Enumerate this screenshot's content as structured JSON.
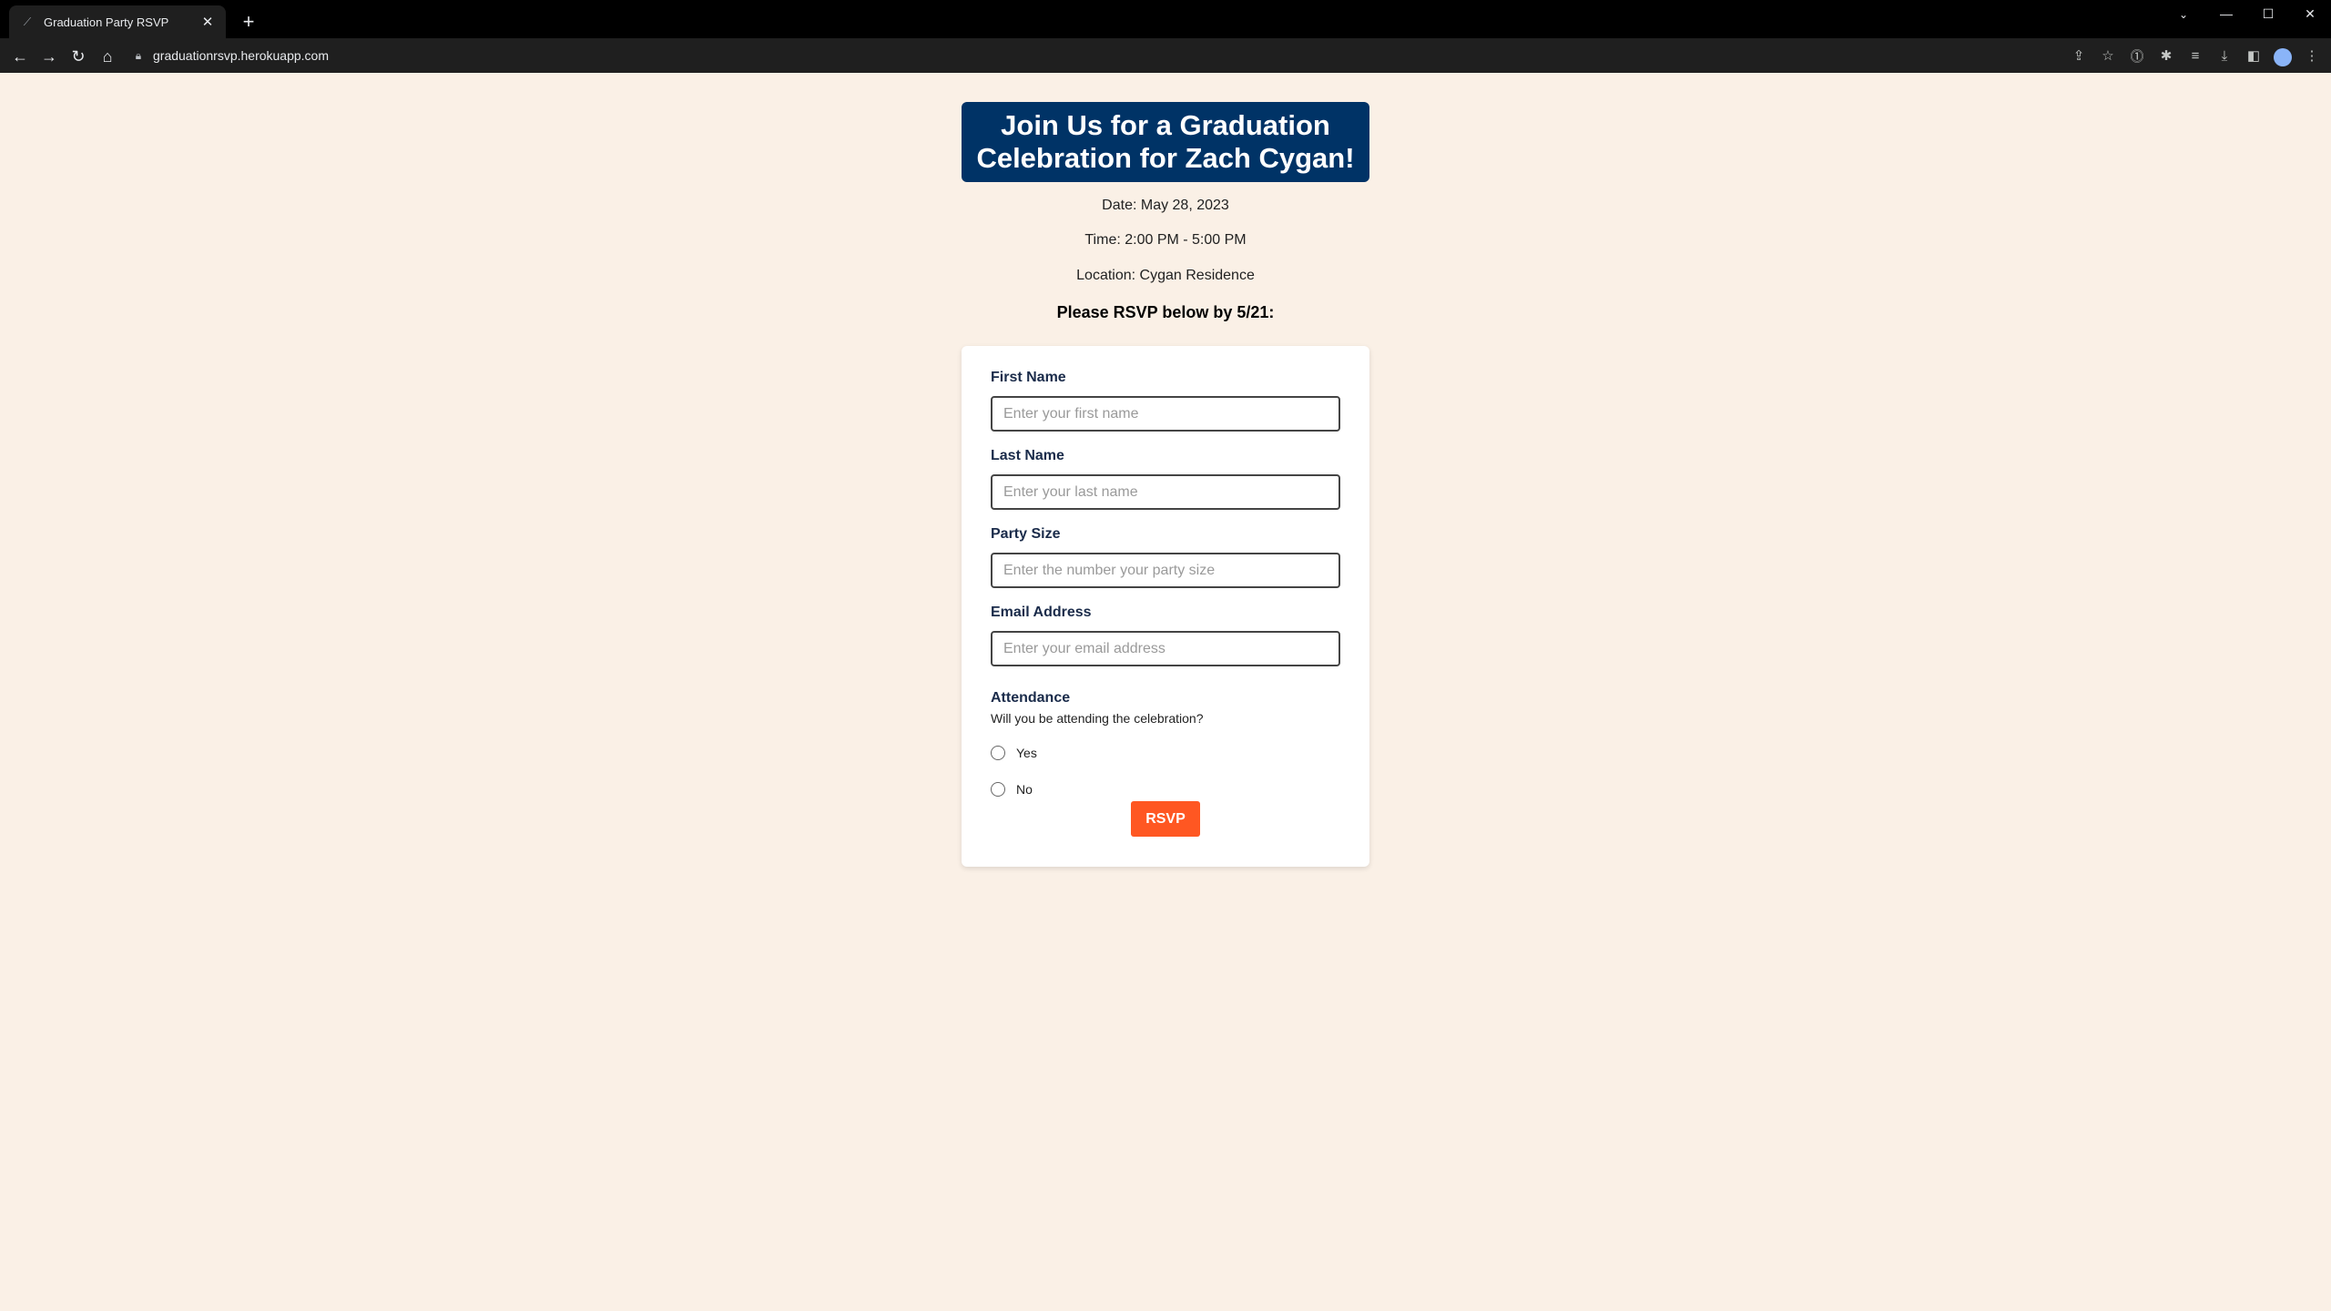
{
  "browser": {
    "tab_title": "Graduation Party RSVP",
    "tab_close": "✕",
    "new_tab": "+",
    "url": "graduationrsvp.herokuapp.com",
    "window_controls": [
      "—",
      "☐",
      "✕"
    ]
  },
  "header": {
    "title": "Join Us for a Graduation Celebration for Zach Cygan!",
    "banner_color": "#003366"
  },
  "event": {
    "date": "Date: May 28, 2023",
    "time": "Time: 2:00 PM - 5:00 PM",
    "location": "Location: Cygan Residence",
    "rsvp_prompt": "Please RSVP below by 5/21:"
  },
  "form": {
    "first_name": {
      "label": "First Name",
      "placeholder": "Enter your first name",
      "value": ""
    },
    "last_name": {
      "label": "Last Name",
      "placeholder": "Enter your last name",
      "value": ""
    },
    "party_size": {
      "label": "Party Size",
      "placeholder": "Enter the number your party size",
      "value": ""
    },
    "email": {
      "label": "Email Address",
      "placeholder": "Enter your email address",
      "value": ""
    },
    "attendance": {
      "label": "Attendance",
      "question": "Will you be attending the celebration?",
      "options": [
        "Yes",
        "No"
      ],
      "selected": null
    },
    "submit_label": "RSVP",
    "submit_color": "#ff5722"
  },
  "colors": {
    "page_background": "#faf0e6",
    "label_color": "#1a2b4a"
  }
}
